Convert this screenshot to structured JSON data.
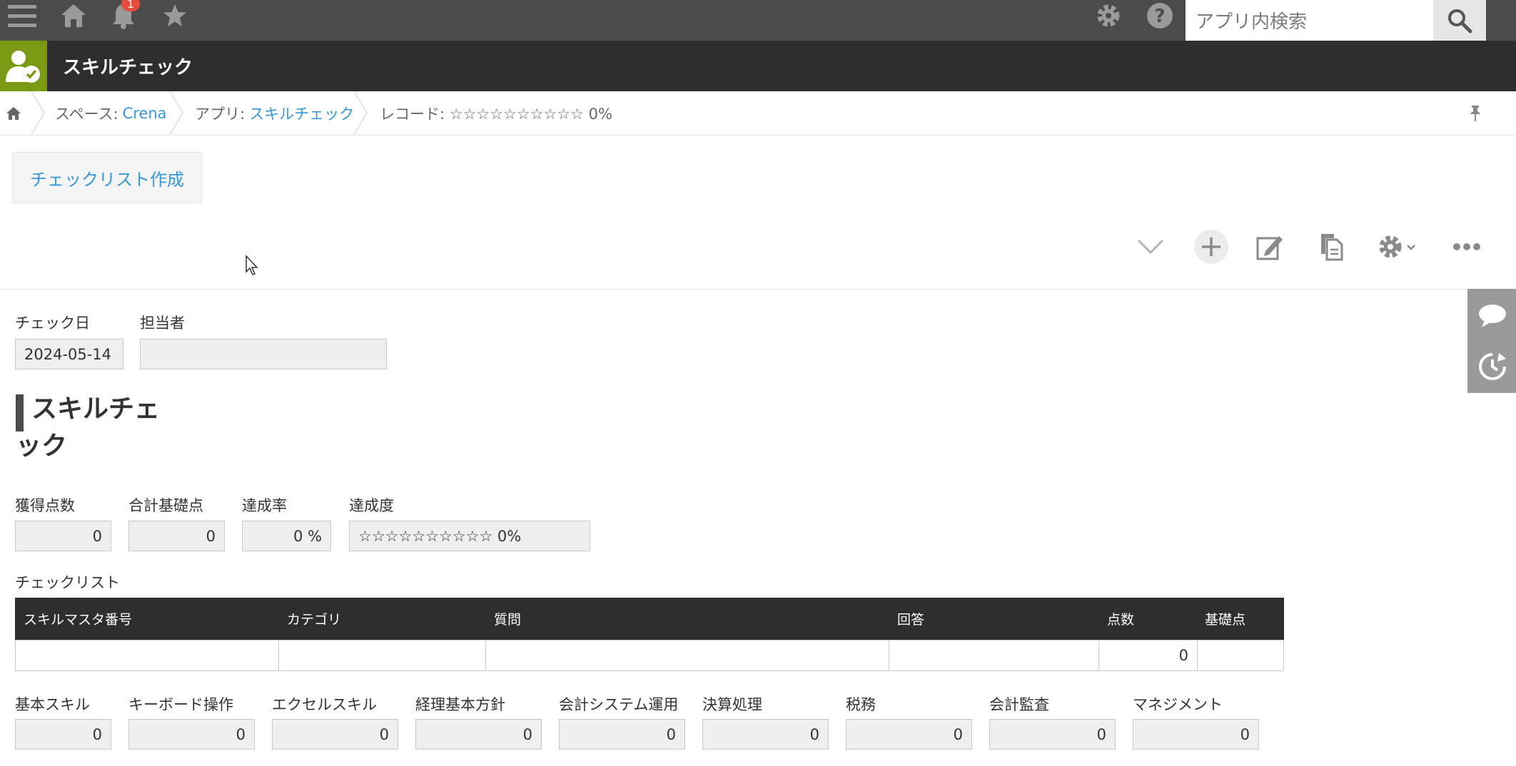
{
  "topbar": {
    "notification_count": "1",
    "search_placeholder": "アプリ内検索",
    "icons": [
      "menu-icon",
      "home-icon",
      "bell-icon",
      "star-icon",
      "gear-icon",
      "help-icon",
      "search-icon"
    ]
  },
  "app": {
    "title": "スキルチェック"
  },
  "breadcrumb": {
    "space_prefix": "スペース:",
    "space_name": "Crena",
    "app_prefix": "アプリ:",
    "app_name": "スキルチェック",
    "record_text": "レコード: ☆☆☆☆☆☆☆☆☆☆ 0%"
  },
  "actions": {
    "create_checklist": "チェックリスト作成"
  },
  "form": {
    "check_date_label": "チェック日",
    "check_date_value": "2024-05-14",
    "assignee_label": "担当者",
    "assignee_value": "",
    "group_title_line1": "スキルチェ",
    "group_title_line2": "ック",
    "score_label": "獲得点数",
    "score_value": "0",
    "base_total_label": "合計基礎点",
    "base_total_value": "0",
    "rate_label": "達成率",
    "rate_value": "0 %",
    "achievement_label": "達成度",
    "achievement_value": "☆☆☆☆☆☆☆☆☆☆ 0%",
    "checklist_label": "チェックリスト"
  },
  "table": {
    "headers": [
      "スキルマスタ番号",
      "カテゴリ",
      "質問",
      "回答",
      "点数",
      "基礎点"
    ],
    "rows": [
      [
        "",
        "",
        "",
        "",
        "0",
        ""
      ]
    ]
  },
  "categories": [
    {
      "label": "基本スキル",
      "value": "0"
    },
    {
      "label": "キーボード操作",
      "value": "0"
    },
    {
      "label": "エクセルスキル",
      "value": "0"
    },
    {
      "label": "経理基本方針",
      "value": "0"
    },
    {
      "label": "会計システム運用",
      "value": "0"
    },
    {
      "label": "決算処理",
      "value": "0"
    },
    {
      "label": "税務",
      "value": "0"
    },
    {
      "label": "会計監査",
      "value": "0"
    },
    {
      "label": "マネジメント",
      "value": "0"
    }
  ]
}
